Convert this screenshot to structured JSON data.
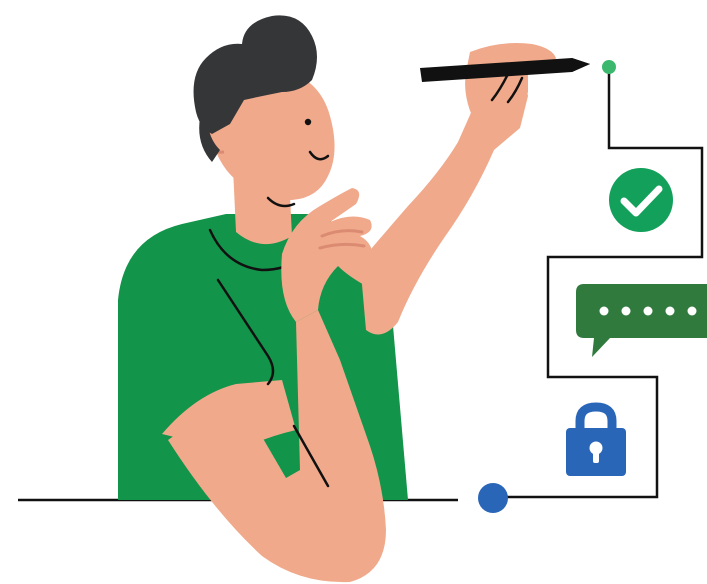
{
  "illustration": {
    "subject": "person-drawing-secure-login-flow",
    "elements": [
      "person",
      "pen",
      "path-start-dot",
      "checkmark-icon",
      "password-speech-bubble",
      "lock-icon",
      "path-end-dot"
    ],
    "colors": {
      "background": "#ffffff",
      "shirt": "#12944a",
      "skin": "#f0a98b",
      "skin_shadow": "#dc8b73",
      "hair": "#353638",
      "line": "#111111",
      "start_dot": "#3cb86e",
      "check_badge": "#12a05a",
      "bubble": "#2f7a3c",
      "lock": "#2a66b8",
      "end_dot": "#2a66b8"
    },
    "password_bubble": {
      "masked_dots": 5
    }
  }
}
